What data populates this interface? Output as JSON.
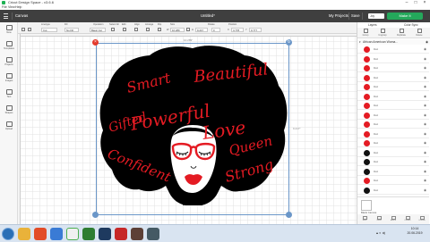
{
  "window": {
    "title": "Cricut Design Space - v3.6.6",
    "menu": [
      "File",
      "View",
      "Help"
    ]
  },
  "header": {
    "section": "Canvas",
    "document_title": "Untitled*",
    "my_projects": "My Projects",
    "save": "Save",
    "machine": "Joy",
    "make_it": "Make It"
  },
  "toolbar": {
    "labels": [
      "Undo",
      "Redo",
      "Linetype",
      "Fill",
      "Operation",
      "Select All",
      "Edit",
      "Align",
      "Arrange",
      "Flip",
      "Size",
      "Rotate",
      "Position"
    ],
    "operation_value": "Basic Cut",
    "size_w_label": "W",
    "size_w": "10.289",
    "size_h_label": "H",
    "size_h": "9.247",
    "rotate": "0",
    "position_x_label": "X",
    "position_x": "4.778",
    "position_y_label": "Y",
    "position_y": "0.777",
    "linetype_value": "Cut",
    "fill_value": "No Fill"
  },
  "left_rail": [
    {
      "label": "New"
    },
    {
      "label": "Templates"
    },
    {
      "label": "Projects"
    },
    {
      "label": "Images"
    },
    {
      "label": "Text"
    },
    {
      "label": "Shapes"
    },
    {
      "label": "Upload"
    }
  ],
  "canvas": {
    "dim_width": "10.289\"",
    "dim_height": "9.247\"",
    "artwork_words": {
      "smart": "Smart",
      "beautiful": "Beautiful",
      "gifted": "Gifted",
      "powerful": "Powerful",
      "love": "Love",
      "queen": "Queen",
      "confident": "Confident",
      "strong": "Strong"
    },
    "colors": {
      "hair": "#000000",
      "text": "#e41b23",
      "selection": "#6a96c8",
      "delete_handle": "#e43b2c"
    }
  },
  "layers": {
    "tabs": {
      "layers": "Layers",
      "color_sync": "Color Sync"
    },
    "tools": [
      "Group",
      "Ungroup",
      "Duplicate",
      "Delete"
    ],
    "group_name": "African American Woma...",
    "rows": [
      {
        "label": "Cut",
        "color": "#e41b23"
      },
      {
        "label": "Cut",
        "color": "#e41b23"
      },
      {
        "label": "Cut",
        "color": "#e41b23"
      },
      {
        "label": "Cut",
        "color": "#e41b23"
      },
      {
        "label": "Cut",
        "color": "#e41b23"
      },
      {
        "label": "Cut",
        "color": "#e41b23"
      },
      {
        "label": "Cut",
        "color": "#e41b23"
      },
      {
        "label": "Cut",
        "color": "#e41b23"
      },
      {
        "label": "Cut",
        "color": "#e41b23"
      },
      {
        "label": "Cut",
        "color": "#e41b23"
      },
      {
        "label": "Cut",
        "color": "#e41b23"
      },
      {
        "label": "Cut",
        "color": "#111111"
      },
      {
        "label": "Cut",
        "color": "#111111"
      },
      {
        "label": "Cut",
        "color": "#111111"
      },
      {
        "label": "Cut",
        "color": "#e41b23"
      },
      {
        "label": "Cut",
        "color": "#111111"
      }
    ],
    "blank_canvas": "Blank Canvas",
    "bottom_tools": [
      "Slice",
      "Weld",
      "Attach",
      "Flatten",
      "Contour"
    ]
  },
  "taskbar": {
    "time": "10:14",
    "date": "20.06.2019"
  }
}
